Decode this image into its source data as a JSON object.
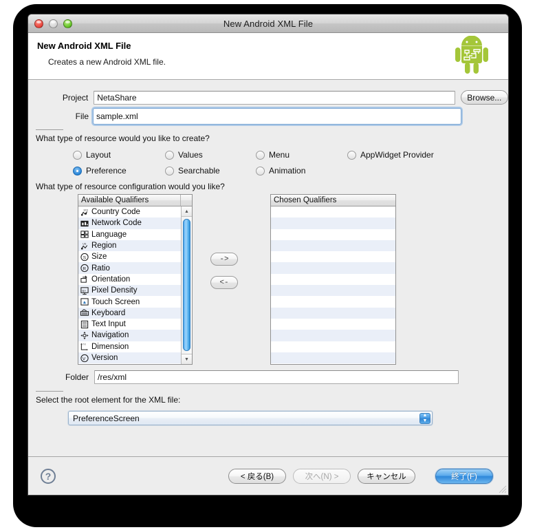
{
  "window": {
    "title": "New Android XML File",
    "traffic_lights": [
      "close-light",
      "minimize-light",
      "zoom-light"
    ]
  },
  "header": {
    "heading": "New Android XML File",
    "subheading": "Creates a new Android XML file.",
    "logo": "android-robot-logo",
    "logo_color": "#a4c639"
  },
  "form": {
    "project_label": "Project",
    "project_value": "NetaShare",
    "browse_label": "Browse...",
    "file_label": "File",
    "file_value": "sample.xml",
    "folder_label": "Folder",
    "folder_value": "/res/xml"
  },
  "resource_type": {
    "question": "What type of resource would you like to create?",
    "options": [
      {
        "label": "Layout",
        "selected": false
      },
      {
        "label": "Values",
        "selected": false
      },
      {
        "label": "Menu",
        "selected": false
      },
      {
        "label": "AppWidget Provider",
        "selected": false
      },
      {
        "label": "Preference",
        "selected": true
      },
      {
        "label": "Searchable",
        "selected": false
      },
      {
        "label": "Animation",
        "selected": false
      }
    ]
  },
  "qualifiers": {
    "question": "What type of resource configuration would you like?",
    "available_header": "Available Qualifiers",
    "chosen_header": "Chosen Qualifiers",
    "available_items": [
      {
        "label": "Country Code",
        "icon": "country-code-icon"
      },
      {
        "label": "Network Code",
        "icon": "network-code-icon"
      },
      {
        "label": "Language",
        "icon": "language-icon"
      },
      {
        "label": "Region",
        "icon": "region-icon"
      },
      {
        "label": "Size",
        "icon": "size-icon"
      },
      {
        "label": "Ratio",
        "icon": "ratio-icon"
      },
      {
        "label": "Orientation",
        "icon": "orientation-icon"
      },
      {
        "label": "Pixel Density",
        "icon": "pixel-density-icon"
      },
      {
        "label": "Touch Screen",
        "icon": "touch-screen-icon"
      },
      {
        "label": "Keyboard",
        "icon": "keyboard-icon"
      },
      {
        "label": "Text Input",
        "icon": "text-input-icon"
      },
      {
        "label": "Navigation",
        "icon": "navigation-icon"
      },
      {
        "label": "Dimension",
        "icon": "dimension-icon"
      },
      {
        "label": "Version",
        "icon": "version-icon"
      }
    ],
    "chosen_items": [],
    "add_button": "->",
    "remove_button": "<-"
  },
  "root_element": {
    "question": "Select the root element for the XML file:",
    "selected": "PreferenceScreen"
  },
  "footer": {
    "help": "?",
    "back": "< 戻る(B)",
    "next": "次へ(N) >",
    "next_disabled": true,
    "cancel": "キャンセル",
    "finish": "終了(F)"
  }
}
